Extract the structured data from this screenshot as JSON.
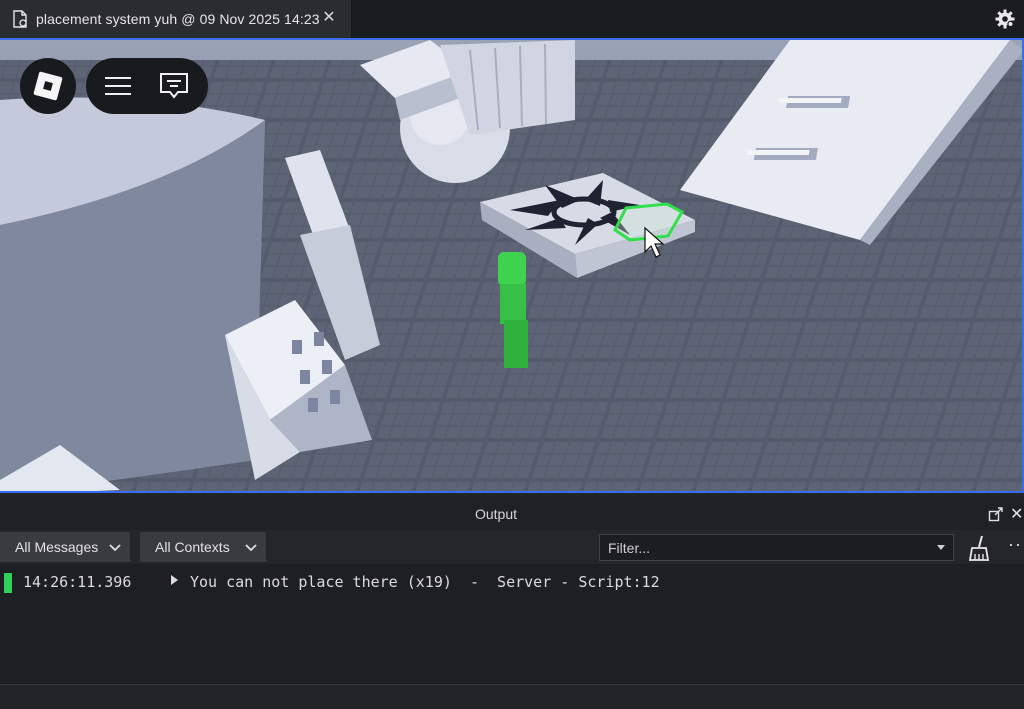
{
  "tab": {
    "title": "placement system yuh @ 09 Nov 2025 14:23",
    "close_glyph": "✕",
    "icon": "document-icon"
  },
  "toolbar": {
    "settings_icon": "settings-gear-icon"
  },
  "viewport": {
    "accent": "#3a6cf0",
    "hud": {
      "logo_icon": "roblox-logo-icon",
      "menu_icon": "hamburger-menu-icon",
      "chat_icon": "chat-bubble-icon"
    },
    "selection_color": "#2ee04a",
    "character_color": "#3fd24f"
  },
  "output": {
    "title": "Output",
    "dock_icon": "undock-icon",
    "close_glyph": "✕",
    "messages_filter": "All Messages",
    "contexts_filter": "All Contexts",
    "filter_placeholder": "Filter...",
    "clear_icon": "broom-icon",
    "more_glyph": "···",
    "entries": [
      {
        "time": "14:26:11.396",
        "message": "You can not place there (x19)  -  Server - Script:12",
        "marker_color": "#2ed15a"
      }
    ]
  }
}
